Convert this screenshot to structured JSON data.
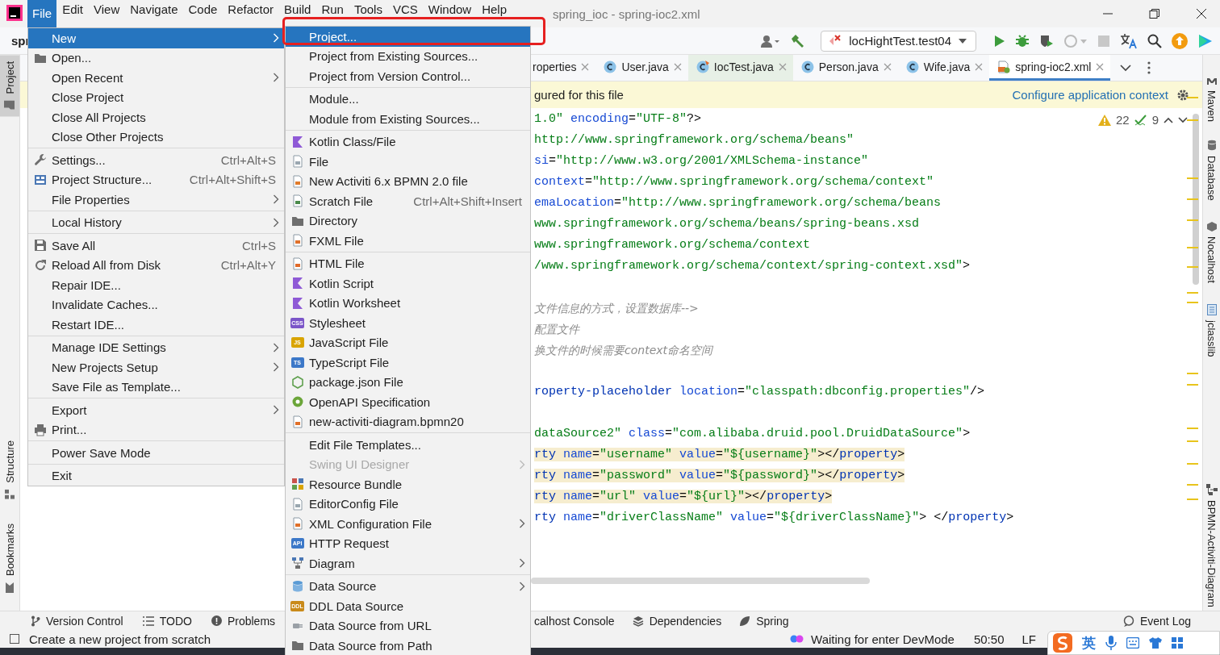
{
  "title_bar": {
    "menus": [
      {
        "label": "File",
        "selected": true
      },
      {
        "label": "Edit",
        "selected": false
      },
      {
        "label": "View",
        "selected": false
      },
      {
        "label": "Navigate",
        "selected": false
      },
      {
        "label": "Code",
        "selected": false
      },
      {
        "label": "Refactor",
        "selected": false
      },
      {
        "label": "Build",
        "selected": false
      },
      {
        "label": "Run",
        "selected": false
      },
      {
        "label": "Tools",
        "selected": false
      },
      {
        "label": "VCS",
        "selected": false
      },
      {
        "label": "Window",
        "selected": false
      },
      {
        "label": "Help",
        "selected": false
      }
    ],
    "title": "spring_ioc - spring-ioc2.xml"
  },
  "toolbar": {
    "breadcrumb": "spr",
    "run_config": "locHightTest.test04"
  },
  "left_tools": [
    {
      "label": "Project",
      "selected": true
    },
    {
      "label": "Structure",
      "selected": false
    },
    {
      "label": "Bookmarks",
      "selected": false
    }
  ],
  "editor": {
    "tabs": [
      {
        "label": "roperties",
        "selected": false,
        "tinted": false
      },
      {
        "label": "User.java",
        "selected": false,
        "tinted": false
      },
      {
        "label": "IocTest.java",
        "selected": false,
        "tinted": true
      },
      {
        "label": "Person.java",
        "selected": false,
        "tinted": false
      },
      {
        "label": "Wife.java",
        "selected": false,
        "tinted": false
      },
      {
        "label": "spring-ioc2.xml",
        "selected": true,
        "tinted": false
      }
    ],
    "banner": {
      "text": "gured for this file",
      "link": "Configure application context"
    },
    "warnings": "22",
    "weak_warnings": "9",
    "lines": [
      {
        "highlighted": false,
        "segments": [
          {
            "kind": "string",
            "text": "1.0\""
          },
          {
            "kind": "attr",
            "text": " encoding"
          },
          {
            "kind": "plain",
            "text": "="
          },
          {
            "kind": "string",
            "text": "\"UTF-8\""
          },
          {
            "kind": "plain",
            "text": "?>"
          }
        ]
      },
      {
        "highlighted": false,
        "segments": [
          {
            "kind": "string",
            "text": "http://www.springframework.org/schema/beans\""
          }
        ]
      },
      {
        "highlighted": false,
        "segments": [
          {
            "kind": "attr",
            "text": "si"
          },
          {
            "kind": "plain",
            "text": "="
          },
          {
            "kind": "string",
            "text": "\"http://www.w3.org/2001/XMLSchema-instance\""
          }
        ]
      },
      {
        "highlighted": false,
        "segments": [
          {
            "kind": "attr",
            "text": "context"
          },
          {
            "kind": "plain",
            "text": "="
          },
          {
            "kind": "string",
            "text": "\"http://www.springframework.org/schema/context\""
          }
        ]
      },
      {
        "highlighted": false,
        "segments": [
          {
            "kind": "attr",
            "text": "emaLocation"
          },
          {
            "kind": "plain",
            "text": "="
          },
          {
            "kind": "string",
            "text": "\"http://www.springframework.org/schema/beans"
          }
        ]
      },
      {
        "highlighted": false,
        "segments": [
          {
            "kind": "string",
            "text": "www.springframework.org/schema/beans/spring-beans.xsd"
          }
        ]
      },
      {
        "highlighted": false,
        "segments": [
          {
            "kind": "string",
            "text": "www.springframework.org/schema/context"
          }
        ]
      },
      {
        "highlighted": false,
        "segments": [
          {
            "kind": "string",
            "text": "/www.springframework.org/schema/context/spring-context.xsd\""
          },
          {
            "kind": "plain",
            "text": ">"
          }
        ]
      },
      {
        "highlighted": false
      },
      {
        "highlighted": false,
        "segments": [
          {
            "kind": "comment",
            "text": "文件信息的方式，设置数据库-->"
          }
        ]
      },
      {
        "highlighted": false,
        "segments": [
          {
            "kind": "comment",
            "text": "配置文件"
          }
        ]
      },
      {
        "highlighted": false,
        "segments": [
          {
            "kind": "comment",
            "text": "换文件的时候需要context命名空间"
          }
        ]
      },
      {
        "highlighted": false
      },
      {
        "highlighted": false,
        "segments": [
          {
            "kind": "tag",
            "text": "roperty-placeholder"
          },
          {
            "kind": "attr",
            "text": " location"
          },
          {
            "kind": "plain",
            "text": "="
          },
          {
            "kind": "string",
            "text": "\"classpath:dbconfig.properties\""
          },
          {
            "kind": "plain",
            "text": "/>"
          }
        ]
      },
      {
        "highlighted": false
      },
      {
        "highlighted": false,
        "segments": [
          {
            "kind": "string",
            "text": "dataSource2\""
          },
          {
            "kind": "attr",
            "text": " class"
          },
          {
            "kind": "plain",
            "text": "="
          },
          {
            "kind": "string",
            "text": "\"com.alibaba.druid.pool.DruidDataSource\""
          },
          {
            "kind": "plain",
            "text": ">"
          }
        ]
      },
      {
        "highlighted": true,
        "segments": [
          {
            "kind": "tag",
            "text": "rty"
          },
          {
            "kind": "attr",
            "text": " name"
          },
          {
            "kind": "plain",
            "text": "="
          },
          {
            "kind": "string",
            "text": "\"username\""
          },
          {
            "kind": "attr",
            "text": " value"
          },
          {
            "kind": "plain",
            "text": "="
          },
          {
            "kind": "string",
            "text": "\"${username}\""
          },
          {
            "kind": "plain",
            "text": "></"
          },
          {
            "kind": "tag",
            "text": "property"
          },
          {
            "kind": "plain",
            "text": ">"
          }
        ]
      },
      {
        "highlighted": true,
        "segments": [
          {
            "kind": "tag",
            "text": "rty"
          },
          {
            "kind": "attr",
            "text": " name"
          },
          {
            "kind": "plain",
            "text": "="
          },
          {
            "kind": "string",
            "text": "\"password\""
          },
          {
            "kind": "attr",
            "text": " value"
          },
          {
            "kind": "plain",
            "text": "="
          },
          {
            "kind": "string",
            "text": "\"${password}\""
          },
          {
            "kind": "plain",
            "text": "></"
          },
          {
            "kind": "tag",
            "text": "property"
          },
          {
            "kind": "plain",
            "text": ">"
          }
        ]
      },
      {
        "highlighted": true,
        "segments": [
          {
            "kind": "tag",
            "text": "rty"
          },
          {
            "kind": "attr",
            "text": " name"
          },
          {
            "kind": "plain",
            "text": "="
          },
          {
            "kind": "string",
            "text": "\"url\""
          },
          {
            "kind": "attr",
            "text": " value"
          },
          {
            "kind": "plain",
            "text": "="
          },
          {
            "kind": "string",
            "text": "\"${url}\""
          },
          {
            "kind": "plain",
            "text": "></"
          },
          {
            "kind": "tag",
            "text": "property"
          },
          {
            "kind": "plain",
            "text": ">"
          }
        ]
      },
      {
        "highlighted": false,
        "segments": [
          {
            "kind": "tag",
            "text": "rty"
          },
          {
            "kind": "attr",
            "text": " name"
          },
          {
            "kind": "plain",
            "text": "="
          },
          {
            "kind": "string",
            "text": "\"driverClassName\""
          },
          {
            "kind": "attr",
            "text": " value"
          },
          {
            "kind": "plain",
            "text": "="
          },
          {
            "kind": "string",
            "text": "\"${driverClassName}\""
          },
          {
            "kind": "plain",
            "text": "> </"
          },
          {
            "kind": "tag",
            "text": "property"
          },
          {
            "kind": "plain",
            "text": ">"
          }
        ]
      }
    ]
  },
  "right_tools": [
    "Maven",
    "Database",
    "Nocalhost",
    "jclasslib",
    "BPMN-Activiti-Diagram"
  ],
  "bottom_tools_left": [
    "Version Control",
    "TODO",
    "Problems"
  ],
  "bottom_tools_right": [
    "calhost Console",
    "Dependencies",
    "Spring"
  ],
  "event_log": "Event Log",
  "status_bar": {
    "message": "Create a new project from scratch",
    "devmode": "Waiting for enter DevMode",
    "position": "50:50",
    "line_ending": "LF"
  },
  "ime": {
    "label": "英"
  },
  "file_menu": [
    {
      "kind": "item",
      "label": "New",
      "selected": true,
      "submenu": true
    },
    {
      "kind": "item",
      "label": "Open...",
      "selected": false,
      "submenu": false
    },
    {
      "kind": "item",
      "label": "Open Recent",
      "selected": false,
      "submenu": true
    },
    {
      "kind": "item",
      "label": "Close Project",
      "selected": false,
      "submenu": false
    },
    {
      "kind": "item",
      "label": "Close All Projects",
      "selected": false,
      "submenu": false
    },
    {
      "kind": "item",
      "label": "Close Other Projects",
      "selected": false,
      "submenu": false
    },
    {
      "kind": "separator"
    },
    {
      "kind": "item",
      "label": "Settings...",
      "selected": false,
      "submenu": false,
      "shortcut": "Ctrl+Alt+S"
    },
    {
      "kind": "item",
      "label": "Project Structure...",
      "selected": false,
      "submenu": false,
      "shortcut": "Ctrl+Alt+Shift+S"
    },
    {
      "kind": "item",
      "label": "File Properties",
      "selected": false,
      "submenu": true
    },
    {
      "kind": "separator"
    },
    {
      "kind": "item",
      "label": "Local History",
      "selected": false,
      "submenu": true
    },
    {
      "kind": "separator"
    },
    {
      "kind": "item",
      "label": "Save All",
      "selected": false,
      "submenu": false,
      "shortcut": "Ctrl+S"
    },
    {
      "kind": "item",
      "label": "Reload All from Disk",
      "selected": false,
      "submenu": false,
      "shortcut": "Ctrl+Alt+Y"
    },
    {
      "kind": "item",
      "label": "Repair IDE...",
      "selected": false,
      "submenu": false
    },
    {
      "kind": "item",
      "label": "Invalidate Caches...",
      "selected": false,
      "submenu": false
    },
    {
      "kind": "item",
      "label": "Restart IDE...",
      "selected": false,
      "submenu": false
    },
    {
      "kind": "separator"
    },
    {
      "kind": "item",
      "label": "Manage IDE Settings",
      "selected": false,
      "submenu": true
    },
    {
      "kind": "item",
      "label": "New Projects Setup",
      "selected": false,
      "submenu": true
    },
    {
      "kind": "item",
      "label": "Save File as Template...",
      "selected": false,
      "submenu": false
    },
    {
      "kind": "separator"
    },
    {
      "kind": "item",
      "label": "Export",
      "selected": false,
      "submenu": true
    },
    {
      "kind": "item",
      "label": "Print...",
      "selected": false,
      "submenu": false
    },
    {
      "kind": "separator"
    },
    {
      "kind": "item",
      "label": "Power Save Mode",
      "selected": false,
      "submenu": false
    },
    {
      "kind": "separator"
    },
    {
      "kind": "item",
      "label": "Exit",
      "selected": false,
      "submenu": false
    }
  ],
  "new_menu": [
    {
      "kind": "item",
      "label": "Project...",
      "selected": true,
      "disabled": false,
      "submenu": false
    },
    {
      "kind": "item",
      "label": "Project from Existing Sources...",
      "selected": false,
      "disabled": false,
      "submenu": false
    },
    {
      "kind": "item",
      "label": "Project from Version Control...",
      "selected": false,
      "disabled": false,
      "submenu": false
    },
    {
      "kind": "separator"
    },
    {
      "kind": "item",
      "label": "Module...",
      "selected": false,
      "disabled": false,
      "submenu": false
    },
    {
      "kind": "item",
      "label": "Module from Existing Sources...",
      "selected": false,
      "disabled": false,
      "submenu": false
    },
    {
      "kind": "separator"
    },
    {
      "kind": "item",
      "label": "Kotlin Class/File",
      "selected": false,
      "disabled": false,
      "submenu": false
    },
    {
      "kind": "item",
      "label": "File",
      "selected": false,
      "disabled": false,
      "submenu": false
    },
    {
      "kind": "item",
      "label": "New Activiti 6.x BPMN 2.0 file",
      "selected": false,
      "disabled": false,
      "submenu": false
    },
    {
      "kind": "item",
      "label": "Scratch File",
      "selected": false,
      "disabled": false,
      "submenu": false,
      "shortcut": "Ctrl+Alt+Shift+Insert"
    },
    {
      "kind": "item",
      "label": "Directory",
      "selected": false,
      "disabled": false,
      "submenu": false
    },
    {
      "kind": "item",
      "label": "FXML File",
      "selected": false,
      "disabled": false,
      "submenu": false
    },
    {
      "kind": "separator"
    },
    {
      "kind": "item",
      "label": "HTML File",
      "selected": false,
      "disabled": false,
      "submenu": false
    },
    {
      "kind": "item",
      "label": "Kotlin Script",
      "selected": false,
      "disabled": false,
      "submenu": false
    },
    {
      "kind": "item",
      "label": "Kotlin Worksheet",
      "selected": false,
      "disabled": false,
      "submenu": false
    },
    {
      "kind": "item",
      "label": "Stylesheet",
      "selected": false,
      "disabled": false,
      "submenu": false,
      "icon_text": "CSS",
      "color": "#7b55c8"
    },
    {
      "kind": "item",
      "label": "JavaScript File",
      "selected": false,
      "disabled": false,
      "submenu": false,
      "icon_text": "JS",
      "color": "#d9a400"
    },
    {
      "kind": "item",
      "label": "TypeScript File",
      "selected": false,
      "disabled": false,
      "submenu": false,
      "icon_text": "TS",
      "color": "#3c78c8"
    },
    {
      "kind": "item",
      "label": "package.json File",
      "selected": false,
      "disabled": false,
      "submenu": false
    },
    {
      "kind": "item",
      "label": "OpenAPI Specification",
      "selected": false,
      "disabled": false,
      "submenu": false
    },
    {
      "kind": "item",
      "label": "new-activiti-diagram.bpmn20",
      "selected": false,
      "disabled": false,
      "submenu": false
    },
    {
      "kind": "separator"
    },
    {
      "kind": "item",
      "label": "Edit File Templates...",
      "selected": false,
      "disabled": false,
      "submenu": false
    },
    {
      "kind": "item",
      "label": "Swing UI Designer",
      "selected": false,
      "disabled": true,
      "submenu": true
    },
    {
      "kind": "item",
      "label": "Resource Bundle",
      "selected": false,
      "disabled": false,
      "submenu": false
    },
    {
      "kind": "item",
      "label": "EditorConfig File",
      "selected": false,
      "disabled": false,
      "submenu": false
    },
    {
      "kind": "item",
      "label": "XML Configuration File",
      "selected": false,
      "disabled": false,
      "submenu": true
    },
    {
      "kind": "item",
      "label": "HTTP Request",
      "selected": false,
      "disabled": false,
      "submenu": false,
      "icon_text": "API",
      "color": "#3c78c8"
    },
    {
      "kind": "item",
      "label": "Diagram",
      "selected": false,
      "disabled": false,
      "submenu": true
    },
    {
      "kind": "separator"
    },
    {
      "kind": "item",
      "label": "Data Source",
      "selected": false,
      "disabled": false,
      "submenu": true
    },
    {
      "kind": "item",
      "label": "DDL Data Source",
      "selected": false,
      "disabled": false,
      "submenu": false,
      "icon_text": "DDL",
      "color": "#c98a1a"
    },
    {
      "kind": "item",
      "label": "Data Source from URL",
      "selected": false,
      "disabled": false,
      "submenu": false
    },
    {
      "kind": "item",
      "label": "Data Source from Path",
      "selected": false,
      "disabled": false,
      "submenu": false
    }
  ]
}
